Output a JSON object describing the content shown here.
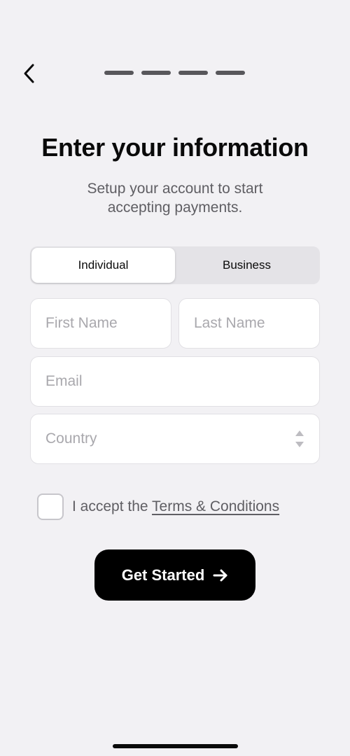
{
  "nav": {
    "back_icon": "chevron-left-icon",
    "progress_steps_total": 4
  },
  "header": {
    "title": "Enter your information",
    "subtitle": "Setup your account to start accepting payments."
  },
  "account_type": {
    "options": [
      "Individual",
      "Business"
    ],
    "selected": "Individual"
  },
  "form": {
    "first_name": {
      "placeholder": "First Name",
      "value": ""
    },
    "last_name": {
      "placeholder": "Last Name",
      "value": ""
    },
    "email": {
      "placeholder": "Email",
      "value": ""
    },
    "country": {
      "placeholder": "Country",
      "value": "",
      "icon": "up-down-stepper-icon"
    }
  },
  "terms": {
    "checked": false,
    "prefix": "I accept the ",
    "link_label": "Terms & Conditions"
  },
  "cta": {
    "label": "Get Started",
    "icon": "arrow-right-icon"
  },
  "colors": {
    "background": "#f2f1f4",
    "primary_button": "#000000",
    "placeholder": "#a9a8ad",
    "secondary_text": "#5f5e63"
  }
}
